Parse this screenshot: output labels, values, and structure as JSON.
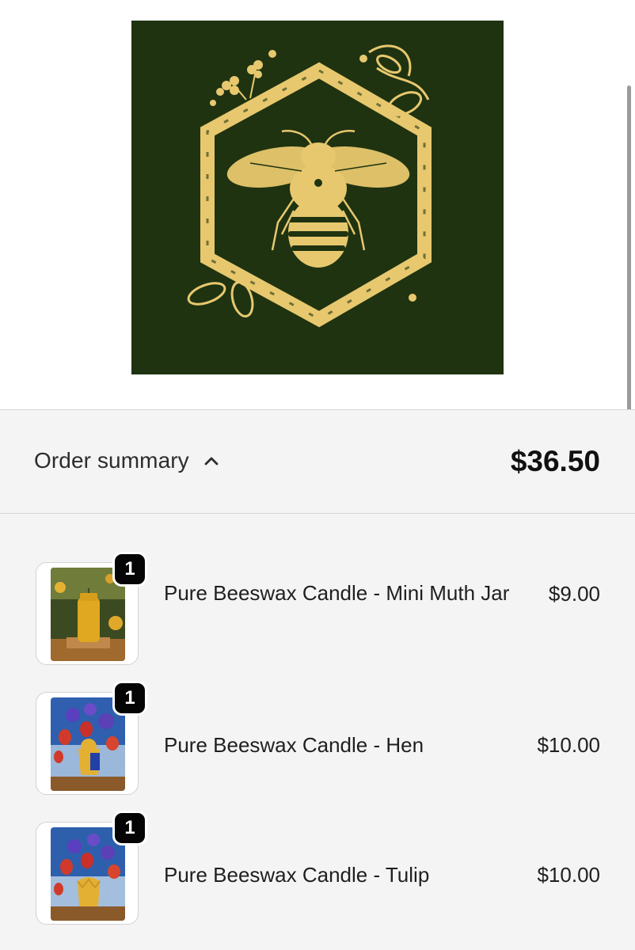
{
  "brand": {
    "logo_icon": "bee-hexagon-logo-icon"
  },
  "colors": {
    "logo_background": "#1f3311",
    "logo_gold": "#e8c86e",
    "summary_background": "#f4f4f4",
    "badge": "#050505"
  },
  "order_summary": {
    "label": "Order summary",
    "toggle_icon": "chevron-up-icon",
    "total": "$36.50"
  },
  "items": [
    {
      "name": "Pure Beeswax Candle - Mini Muth Jar",
      "price": "$9.00",
      "quantity": "1",
      "thumb_icon": "jar-candle-photo"
    },
    {
      "name": "Pure Beeswax Candle - Hen",
      "price": "$10.00",
      "quantity": "1",
      "thumb_icon": "hen-candle-photo"
    },
    {
      "name": "Pure Beeswax Candle - Tulip",
      "price": "$10.00",
      "quantity": "1",
      "thumb_icon": "tulip-candle-photo"
    }
  ]
}
